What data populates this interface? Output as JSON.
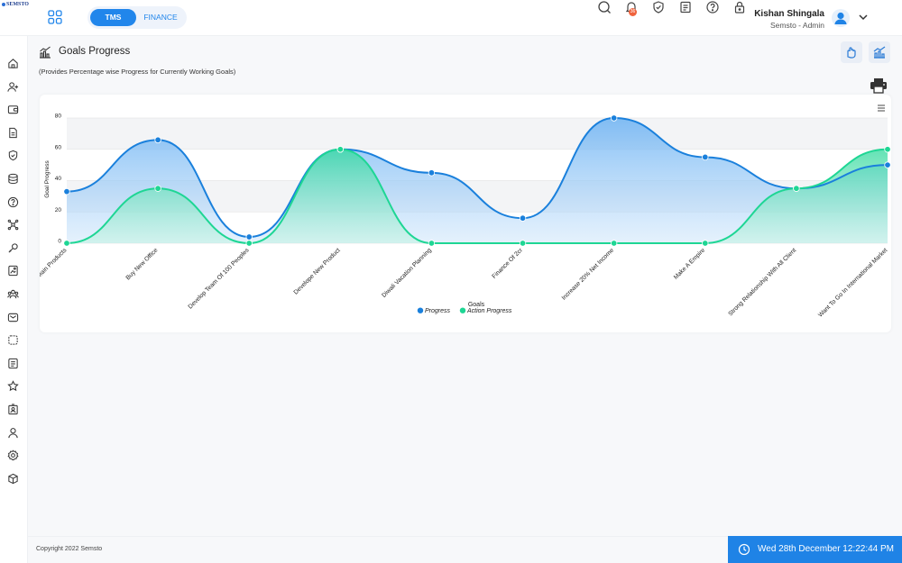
{
  "logo": {
    "text": "SEMSTO"
  },
  "header": {
    "modules": [
      {
        "label": "TMS",
        "active": true
      },
      {
        "label": "FINANCE",
        "active": false
      }
    ],
    "notification_count": "36",
    "user": {
      "name": "Kishan Shingala",
      "role": "Semsto - Admin"
    },
    "icons": [
      "search-icon",
      "bell-icon",
      "shield-check-icon",
      "notes-icon",
      "help-icon",
      "lock-icon"
    ]
  },
  "sidebar": {
    "icons": [
      "home-icon",
      "user-add-icon",
      "wallet-icon",
      "document-icon",
      "shield-icon",
      "database-icon",
      "help-icon",
      "network-icon",
      "tool-icon",
      "image-icon",
      "team-icon",
      "mail-icon",
      "puzzle-icon",
      "list-icon",
      "star-icon",
      "id-card-icon",
      "user-icon",
      "settings-icon",
      "box-icon"
    ]
  },
  "page": {
    "title": "Goals Progress",
    "subtitle": "(Provides Percentage wise Progress for Currently Working Goals)"
  },
  "chart_data": {
    "type": "area",
    "xlabel": "Goals",
    "ylabel": "Goal Progress",
    "ylim": [
      0,
      80
    ],
    "yticks": [
      0,
      20,
      40,
      60,
      80
    ],
    "grid": true,
    "legend": "bottom-center",
    "categories": [
      "Main Products",
      "Buy New Office",
      "Develop Team Of 100 Peoples",
      "Develope New Product",
      "Diwali Vacation Planning",
      "Finance Of 2cr",
      "Increase 20% Net Income",
      "Make A Empire",
      "Strong Relationship With All Client",
      "Want To Go In International Market"
    ],
    "series": [
      {
        "name": "Progress",
        "color": "#1a80dc",
        "values": [
          33,
          66,
          4,
          60,
          45,
          16,
          80,
          55,
          35,
          50
        ]
      },
      {
        "name": "Action Progress",
        "color": "#1ed694",
        "values": [
          0,
          35,
          0,
          60,
          0,
          0,
          0,
          0,
          35,
          60
        ]
      }
    ]
  },
  "footer": {
    "copyright": "Copyright 2022 Semsto",
    "datetime": "Wed 28th December 12:22:44 PM"
  }
}
